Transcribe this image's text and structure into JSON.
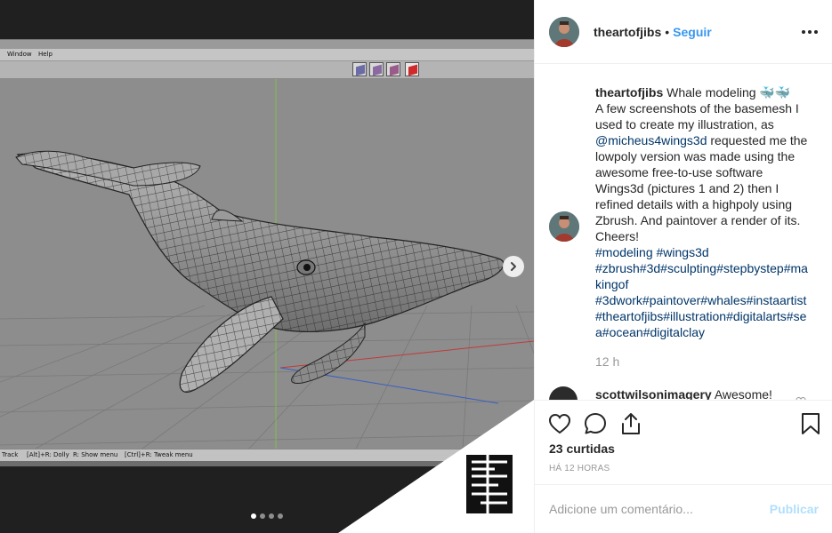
{
  "media": {
    "menu": [
      "Window",
      "Help"
    ],
    "status": [
      "Track",
      "[Alt]+R: Dolly",
      "R: Show menu",
      "[Ctrl]+R: Tweak menu"
    ],
    "tool_icons": [
      "view-cube-icon",
      "view-cube-icon",
      "view-cube-icon",
      "view-cube-icon"
    ],
    "carousel": {
      "total": 4,
      "active": 1
    },
    "next_icon": "chevron-right-icon"
  },
  "post": {
    "username": "theartofjibs",
    "separator": "•",
    "follow_label": "Seguir",
    "more_icon": "more-horizontal-icon"
  },
  "caption": {
    "username": "theartofjibs",
    "text_1": " Whale modeling 🐳🐳",
    "text_2": "A few screenshots of the basemesh I used to create my illustration, as ",
    "mention": "@micheus4wings3d",
    "text_3": " requested me the lowpoly version was made using the awesome free-to-use software Wings3d (pictures 1 and 2) then I refined details with a highpoly using Zbrush. And paintover a render of its. Cheers!",
    "hashtags_1": "#modeling #wings3d",
    "hashtags_2": "#zbrush#3d#sculpting#stepbystep#makingof",
    "hashtags_3": "#3dwork#paintover#whales#instaartist#theartofjibs#illustration#digitalarts#sea#ocean#digitalclay",
    "time": "12 h"
  },
  "comment": {
    "username": "scottwilsonimagery",
    "text": " Awesome!"
  },
  "actions": {
    "like_icon": "heart-icon",
    "comment_icon": "comment-icon",
    "share_icon": "share-icon",
    "save_icon": "bookmark-icon",
    "likes": "23 curtidas",
    "ago": "HÁ 12 HORAS"
  },
  "add_comment": {
    "placeholder": "Adicione um comentário...",
    "publish_label": "Publicar"
  },
  "colors": {
    "link": "#003569",
    "follow": "#3897f0",
    "publish_disabled": "#b2dffc",
    "viewport": "#8d8d8d"
  }
}
